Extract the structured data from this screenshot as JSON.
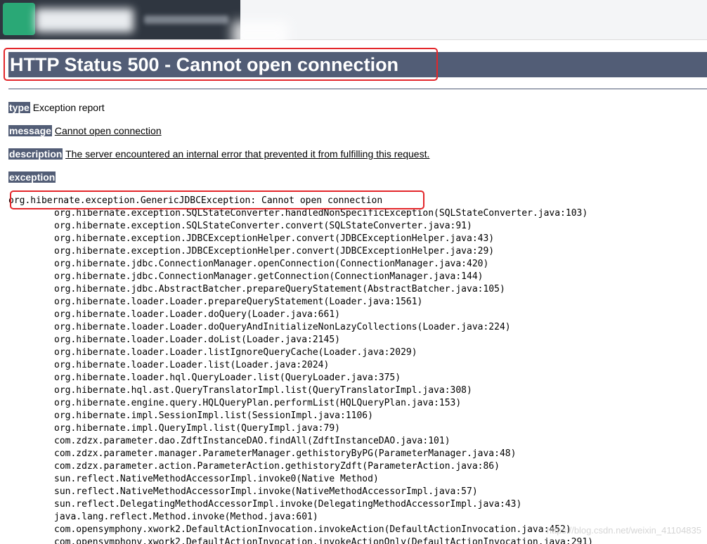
{
  "page": {
    "title": "HTTP Status 500 - Cannot open connection",
    "fields": [
      {
        "label": "type",
        "value": "Exception report"
      },
      {
        "label": "message",
        "value": "Cannot open connection"
      },
      {
        "label": "description",
        "value": "The server encountered an internal error that prevented it from fulfilling this request."
      },
      {
        "label": "exception",
        "value": ""
      }
    ],
    "exception_head": "org.hibernate.exception.GenericJDBCException: Cannot open connection",
    "stack": [
      "org.hibernate.exception.SQLStateConverter.handledNonSpecificException(SQLStateConverter.java:103)",
      "org.hibernate.exception.SQLStateConverter.convert(SQLStateConverter.java:91)",
      "org.hibernate.exception.JDBCExceptionHelper.convert(JDBCExceptionHelper.java:43)",
      "org.hibernate.exception.JDBCExceptionHelper.convert(JDBCExceptionHelper.java:29)",
      "org.hibernate.jdbc.ConnectionManager.openConnection(ConnectionManager.java:420)",
      "org.hibernate.jdbc.ConnectionManager.getConnection(ConnectionManager.java:144)",
      "org.hibernate.jdbc.AbstractBatcher.prepareQueryStatement(AbstractBatcher.java:105)",
      "org.hibernate.loader.Loader.prepareQueryStatement(Loader.java:1561)",
      "org.hibernate.loader.Loader.doQuery(Loader.java:661)",
      "org.hibernate.loader.Loader.doQueryAndInitializeNonLazyCollections(Loader.java:224)",
      "org.hibernate.loader.Loader.doList(Loader.java:2145)",
      "org.hibernate.loader.Loader.listIgnoreQueryCache(Loader.java:2029)",
      "org.hibernate.loader.Loader.list(Loader.java:2024)",
      "org.hibernate.loader.hql.QueryLoader.list(QueryLoader.java:375)",
      "org.hibernate.hql.ast.QueryTranslatorImpl.list(QueryTranslatorImpl.java:308)",
      "org.hibernate.engine.query.HQLQueryPlan.performList(HQLQueryPlan.java:153)",
      "org.hibernate.impl.SessionImpl.list(SessionImpl.java:1106)",
      "org.hibernate.impl.QueryImpl.list(QueryImpl.java:79)",
      "com.zdzx.parameter.dao.ZdftInstanceDAO.findAll(ZdftInstanceDAO.java:101)",
      "com.zdzx.parameter.manager.ParameterManager.gethistoryByPG(ParameterManager.java:48)",
      "com.zdzx.parameter.action.ParameterAction.gethistoryZdft(ParameterAction.java:86)",
      "sun.reflect.NativeMethodAccessorImpl.invoke0(Native Method)",
      "sun.reflect.NativeMethodAccessorImpl.invoke(NativeMethodAccessorImpl.java:57)",
      "sun.reflect.DelegatingMethodAccessorImpl.invoke(DelegatingMethodAccessorImpl.java:43)",
      "java.lang.reflect.Method.invoke(Method.java:601)",
      "com.opensymphony.xwork2.DefaultActionInvocation.invokeAction(DefaultActionInvocation.java:452)",
      "com.opensymphony.xwork2.DefaultActionInvocation.invokeActionOnly(DefaultActionInvocation.java:291)"
    ],
    "watermark": "https://blog.csdn.net/weixin_41104835"
  },
  "colors": {
    "header_bg": "#525d76",
    "highlight_red": "#e3262a"
  }
}
